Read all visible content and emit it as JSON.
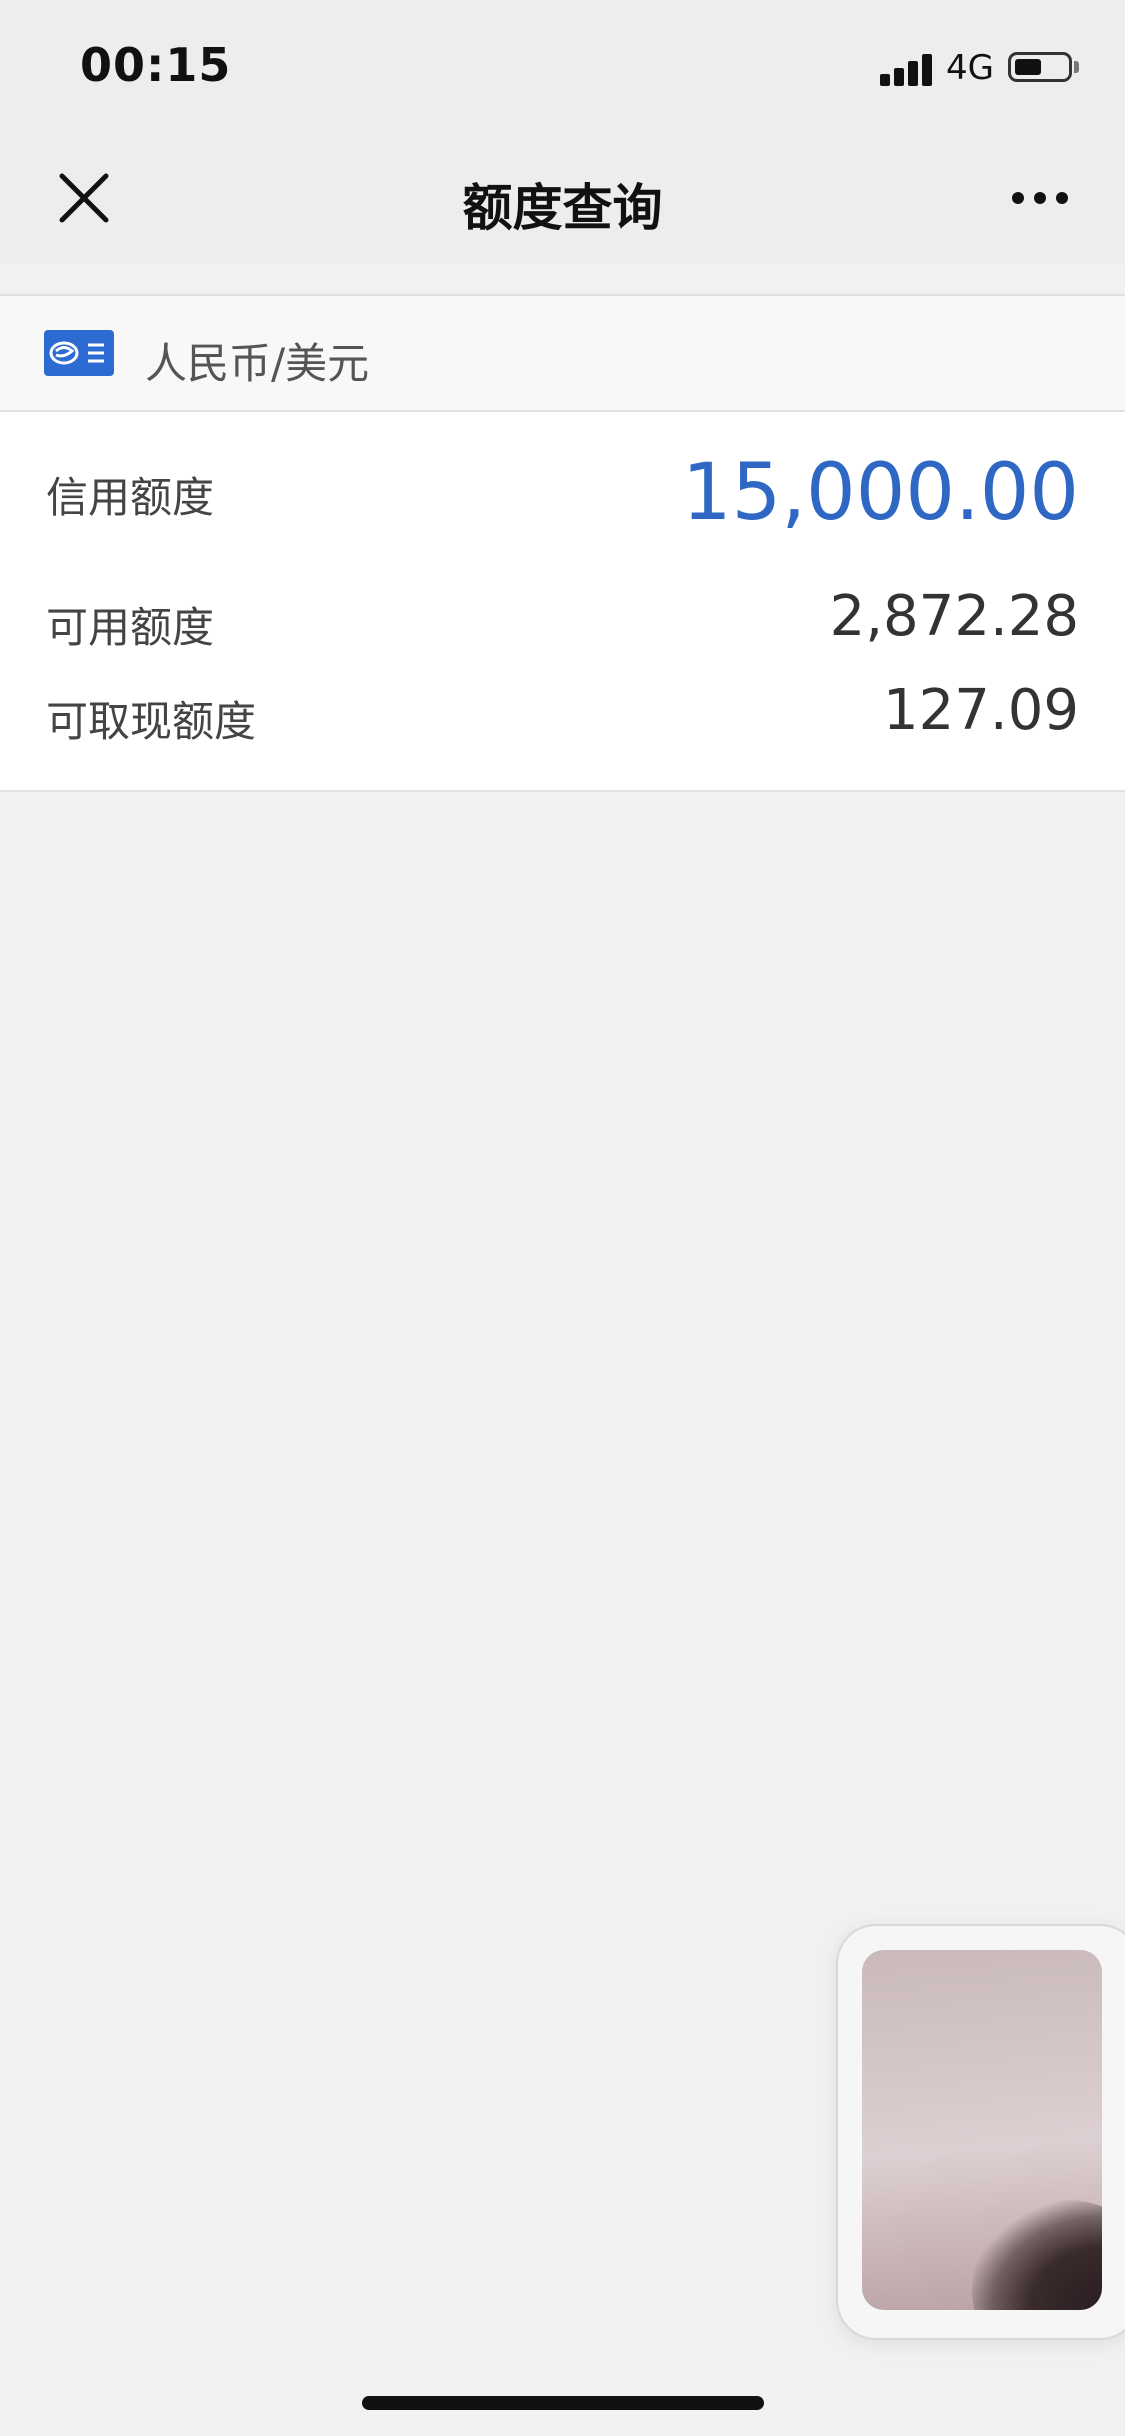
{
  "status_bar": {
    "time": "00:15",
    "network": "4G",
    "battery_level": 0.45
  },
  "nav": {
    "title": "额度查询",
    "close_icon": "close-icon",
    "more_icon": "more-dots-icon"
  },
  "currency": {
    "logo_icon": "bank-logo-icon",
    "label": "人民币/美元"
  },
  "limits": [
    {
      "label": "信用额度",
      "value": "15,000.00"
    },
    {
      "label": "可用额度",
      "value": "2,872.28"
    },
    {
      "label": "可取现额度",
      "value": "127.09"
    }
  ],
  "colors": {
    "accent": "#2f67c4",
    "bank_logo": "#2c6bd1",
    "background": "#f1f1f1"
  }
}
